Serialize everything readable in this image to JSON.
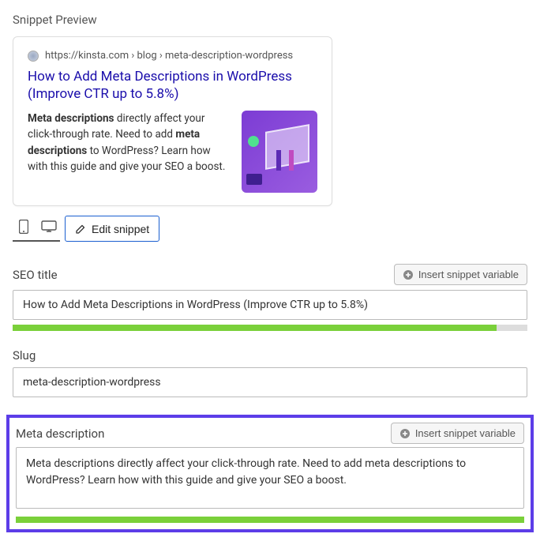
{
  "section_label": "Snippet Preview",
  "preview": {
    "url": "https://kinsta.com › blog › meta-description-wordpress",
    "title": "How to Add Meta Descriptions in WordPress (Improve CTR up to 5.8%)",
    "description_parts": {
      "bold1": "Meta descriptions",
      "text1": " directly affect your click-through rate. Need to add ",
      "bold2": "meta descriptions",
      "text2": " to WordPress? Learn how with this guide and give your SEO a boost."
    }
  },
  "toolbar": {
    "edit_snippet_label": "Edit snippet"
  },
  "fields": {
    "seo_title": {
      "label": "SEO title",
      "value": "How to Add Meta Descriptions in WordPress (Improve CTR up to 5.8%)",
      "insert_var_label": "Insert snippet variable",
      "progress_percent": 94
    },
    "slug": {
      "label": "Slug",
      "value": "meta-description-wordpress"
    },
    "meta_description": {
      "label": "Meta description",
      "value": "Meta descriptions directly affect your click-through rate. Need to add meta descriptions to WordPress? Learn how with this guide and give your SEO a boost.",
      "insert_var_label": "Insert snippet variable",
      "progress_percent": 100
    }
  }
}
